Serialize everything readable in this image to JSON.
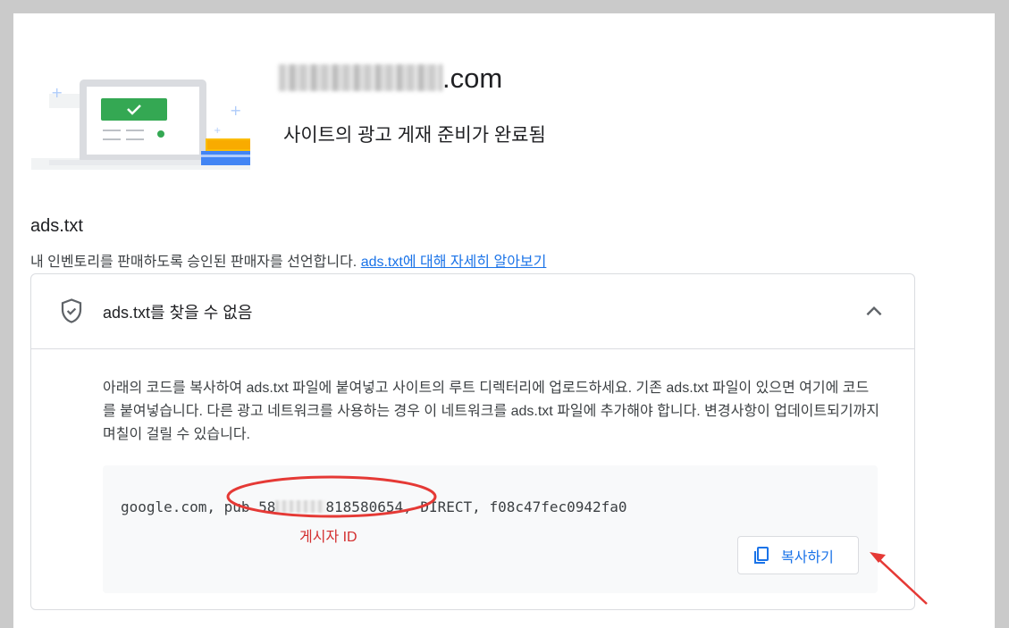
{
  "header": {
    "site_suffix": ".com",
    "subtitle": "사이트의 광고 게재 준비가 완료됨"
  },
  "section": {
    "title": "ads.txt",
    "description": "내 인벤토리를 판매하도록 승인된 판매자를 선언합니다. ",
    "learn_more_link": "ads.txt에 대해 자세히 알아보기"
  },
  "card": {
    "title": "ads.txt를 찾을 수 없음",
    "instructions": "아래의 코드를 복사하여 ads.txt 파일에 붙여넣고 사이트의 루트 디렉터리에 업로드하세요. 기존 ads.txt 파일이 있으면 여기에 코드를 붙여넣습니다. 다른 광고 네트워크를 사용하는 경우 이 네트워크를 ads.txt 파일에 추가해야 합니다. 변경사항이 업데이트되기까지 며칠이 걸릴 수 있습니다.",
    "code_prefix": "google.com, pub",
    "code_pub_start": "58",
    "code_pub_end": "818580654",
    "code_suffix": ", DIRECT, f08c47fec0942fa0",
    "copy_button": "복사하기"
  },
  "annotation": {
    "label": "게시자 ID",
    "color": "#d32f2f"
  },
  "colors": {
    "link": "#1a73e8",
    "success_green": "#34a853"
  },
  "icons": [
    "shield-check-icon",
    "chevron-up-icon",
    "copy-icon",
    "checkmark-icon"
  ]
}
